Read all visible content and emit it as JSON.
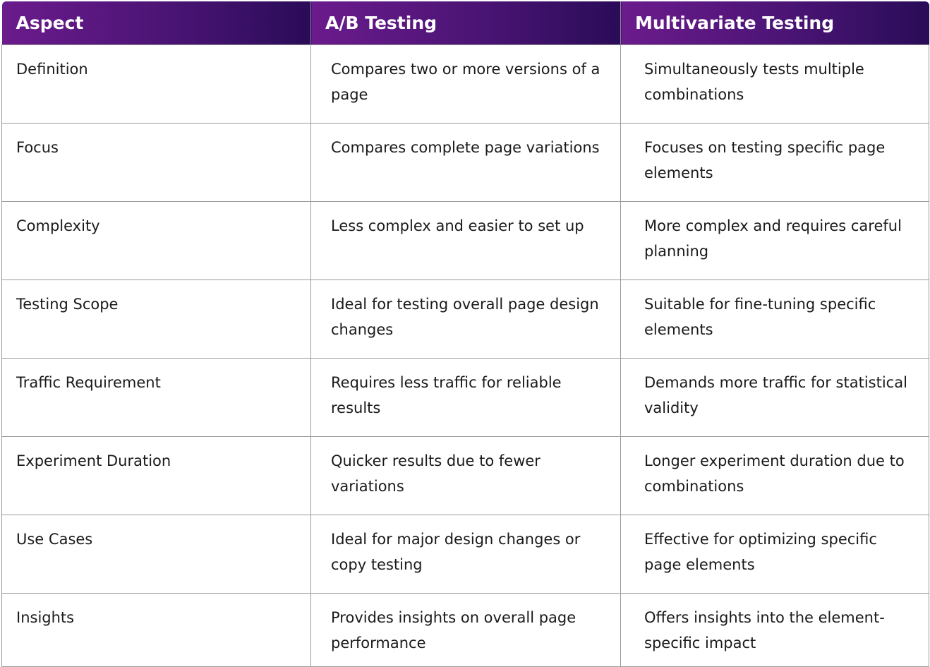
{
  "headers": [
    "Aspect",
    "A/B Testing",
    "Multivariate Testing"
  ],
  "colors": {
    "header_gradient_start": "#6b1b8c",
    "header_gradient_end": "#2a0c58",
    "border": "#9a9a9a"
  },
  "rows": [
    [
      "Definition",
      "Compares two or more versions of a page",
      "Simultaneously tests multiple combinations"
    ],
    [
      "Focus",
      "Compares complete page variations",
      "Focuses on testing specific page elements"
    ],
    [
      "Complexity",
      "Less complex and easier to set up",
      "More complex and requires careful planning"
    ],
    [
      "Testing Scope",
      "Ideal for testing overall page design changes",
      "Suitable for fine-tuning specific elements"
    ],
    [
      "Traffic Requirement",
      "Requires less traffic for reliable results",
      "Demands more traffic for statistical validity"
    ],
    [
      "Experiment Duration",
      "Quicker results due to fewer variations",
      "Longer experiment duration due to combinations"
    ],
    [
      "Use Cases",
      "Ideal for major design changes or copy testing",
      "Effective for optimizing specific page elements"
    ],
    [
      "Insights",
      "Provides insights on overall page performance",
      "Offers insights into the element-specific impact"
    ]
  ]
}
